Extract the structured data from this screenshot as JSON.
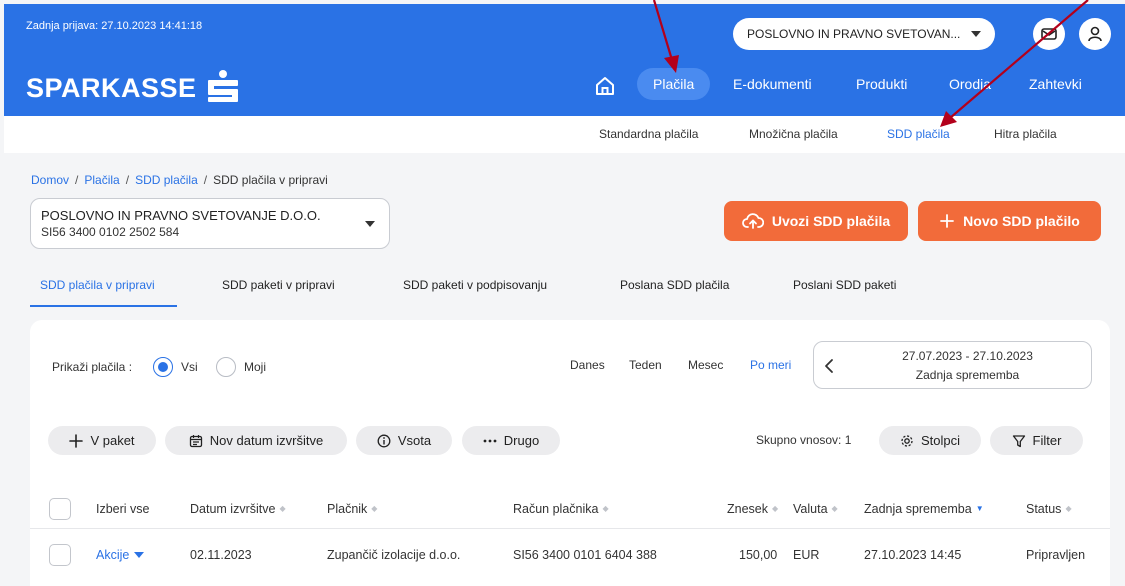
{
  "header": {
    "last_login": "Zadnja prijava: 27.10.2023 14:41:18",
    "logo_text": "SPARKASSE",
    "account_pill": "POSLOVNO IN PRAVNO SVETOVAN...",
    "nav": [
      "Plačila",
      "E-dokumenti",
      "Produkti",
      "Orodja",
      "Zahtevki"
    ]
  },
  "subnav": [
    "Standardna plačila",
    "Množična plačila",
    "SDD plačila",
    "Hitra plačila"
  ],
  "breadcrumb": {
    "home": "Domov",
    "payments": "Plačila",
    "sdd": "SDD plačila",
    "current": "SDD plačila v pripravi",
    "sep": "/"
  },
  "account_select": {
    "name": "POSLOVNO IN PRAVNO SVETOVANJE D.O.O.",
    "iban": "SI56 3400 0102 2502 584"
  },
  "actions": {
    "import": "Uvozi SDD plačila",
    "new": "Novo SDD plačilo"
  },
  "tabs": [
    "SDD plačila v pripravi",
    "SDD paketi v pripravi",
    "SDD paketi v podpisovanju",
    "Poslana SDD plačila",
    "Poslani SDD paketi"
  ],
  "filters": {
    "show_label": "Prikaži plačila :",
    "all": "Vsi",
    "mine": "Moji",
    "periods": [
      "Danes",
      "Teden",
      "Mesec",
      "Po meri"
    ],
    "date_range": "27.07.2023 - 27.10.2023",
    "date_field": "Zadnja sprememba"
  },
  "toolbar": {
    "package": "V paket",
    "new_date": "Nov datum izvršitve",
    "sum": "Vsota",
    "other": "Drugo",
    "total": "Skupno vnosov: 1",
    "columns": "Stolpci",
    "filter": "Filter"
  },
  "table": {
    "headers": [
      "Izberi vse",
      "Datum izvršitve",
      "Plačnik",
      "Račun plačnika",
      "Znesek",
      "Valuta",
      "Zadnja sprememba",
      "Status"
    ],
    "rows": [
      {
        "actions": "Akcije",
        "date": "02.11.2023",
        "payer": "Zupančič izolacije d.o.o.",
        "account": "SI56 3400 0101 6404 388",
        "amount": "150,00",
        "currency": "EUR",
        "modified": "27.10.2023 14:45",
        "status": "Pripravljen"
      }
    ]
  },
  "colors": {
    "brand_blue": "#2a72e5",
    "accent_orange": "#f26b3a",
    "annotation_red": "#b3001b"
  }
}
